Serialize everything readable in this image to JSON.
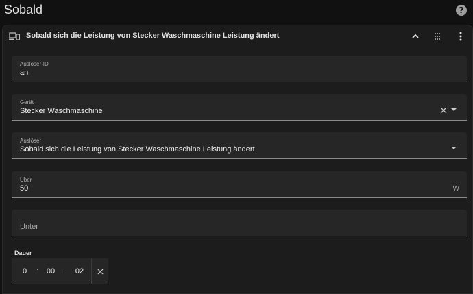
{
  "page": {
    "title": "Sobald",
    "help_icon": "help-circle-icon",
    "help_glyph": "?"
  },
  "card": {
    "title": "Sobald sich die Leistung von Stecker Waschmaschine Leistung ändert",
    "trigger_icon": "devices-icon",
    "actions": [
      "chevron-up-icon",
      "drag-handle-icon",
      "dots-vertical-icon"
    ]
  },
  "fields": {
    "trigger_id": {
      "label": "Auslöser-ID",
      "value": "an"
    },
    "device": {
      "label": "Gerät",
      "value": "Stecker Waschmaschine"
    },
    "trigger": {
      "label": "Auslöser",
      "value": "Sobald sich die Leistung von Stecker Waschmaschine Leistung ändert"
    },
    "above": {
      "label": "Über",
      "value": "50",
      "suffix": "W"
    },
    "below": {
      "placeholder": "Unter"
    }
  },
  "duration": {
    "label": "Dauer",
    "hours": "0",
    "minutes": "00",
    "seconds": "02",
    "separator": ":"
  }
}
